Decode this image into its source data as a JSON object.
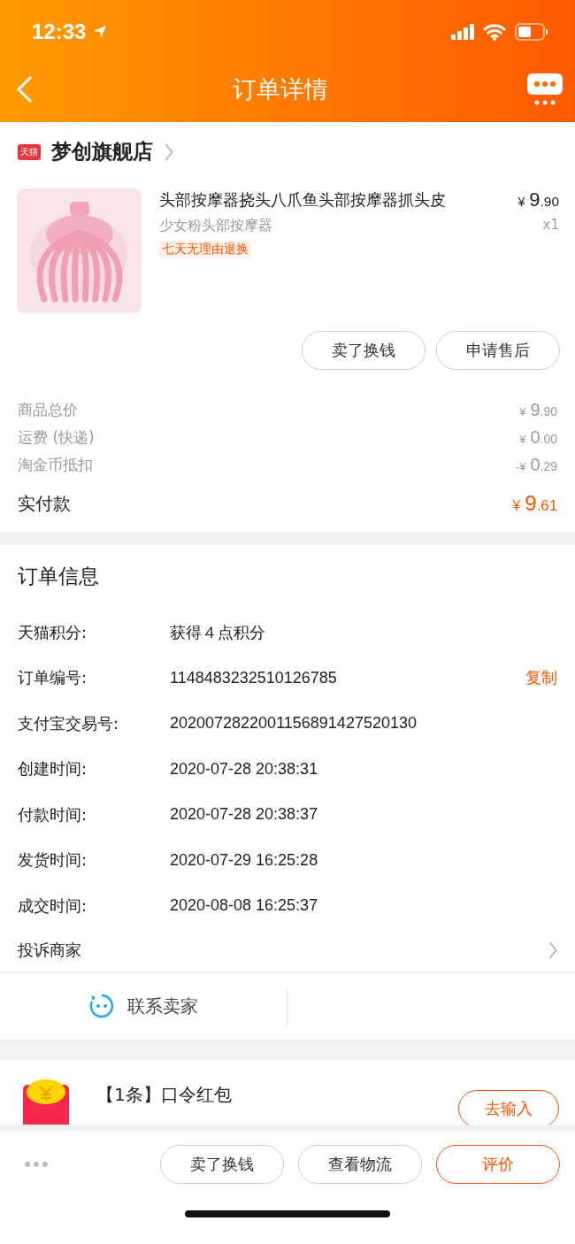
{
  "status_bar": {
    "time": "12:33"
  },
  "nav": {
    "title": "订单详情"
  },
  "store": {
    "badge": "天猫",
    "name": "梦创旗舰店"
  },
  "product": {
    "kind": "picture",
    "title": "头部按摩器挠头八爪鱼头部按摩器抓头皮",
    "spec": "少女粉头部按摩器",
    "tag": "七天无理由退换",
    "currency": "¥",
    "integer": "9",
    "decimals": ".90",
    "quantity": "x1"
  },
  "product_actions": [
    "卖了换钱",
    "申请售后"
  ],
  "price_rows": [
    {
      "kind": "subtotal",
      "label": "商品总价",
      "currency": "¥",
      "integer": "9",
      "decimals": ".90"
    },
    {
      "kind": "subtotal",
      "label": "运费 (快递)",
      "currency": "¥",
      "integer": "0",
      "decimals": ".00"
    },
    {
      "kind": "subtotal",
      "label": "淘金币抵扣",
      "currency": "-¥",
      "integer": "0",
      "decimals": ".29"
    },
    {
      "kind": "total",
      "label": "实付款",
      "currency": "¥",
      "integer": "9",
      "decimals": ".61"
    }
  ],
  "order_info": {
    "title": "订单信息",
    "rows": [
      {
        "kind": "field",
        "label": "天猫积分:",
        "value": "获得４点积分"
      },
      {
        "kind": "field",
        "label": "订单编号:",
        "value": "1148483232510126785",
        "action": "复制"
      },
      {
        "kind": "field",
        "label": "支付宝交易号:",
        "value": "2020072822001156891427520130"
      },
      {
        "kind": "field",
        "label": "创建时间:",
        "value": "2020-07-28 20:38:31"
      },
      {
        "kind": "field",
        "label": "付款时间:",
        "value": "2020-07-28 20:38:37"
      },
      {
        "kind": "field",
        "label": "发货时间:",
        "value": "2020-07-29 16:25:28"
      },
      {
        "kind": "field",
        "label": "成交时间:",
        "value": "2020-08-08 16:25:37"
      },
      {
        "kind": "link",
        "label": "投诉商家"
      }
    ]
  },
  "contact": {
    "label": "联系卖家"
  },
  "red_packet": {
    "title": "【1条】口令红包",
    "button": "去输入"
  },
  "bottom_bar": {
    "buttons": [
      {
        "label": "卖了换钱",
        "kind": "outline"
      },
      {
        "label": "查看物流",
        "kind": "outline"
      },
      {
        "label": "评价",
        "kind": "accent"
      }
    ]
  }
}
